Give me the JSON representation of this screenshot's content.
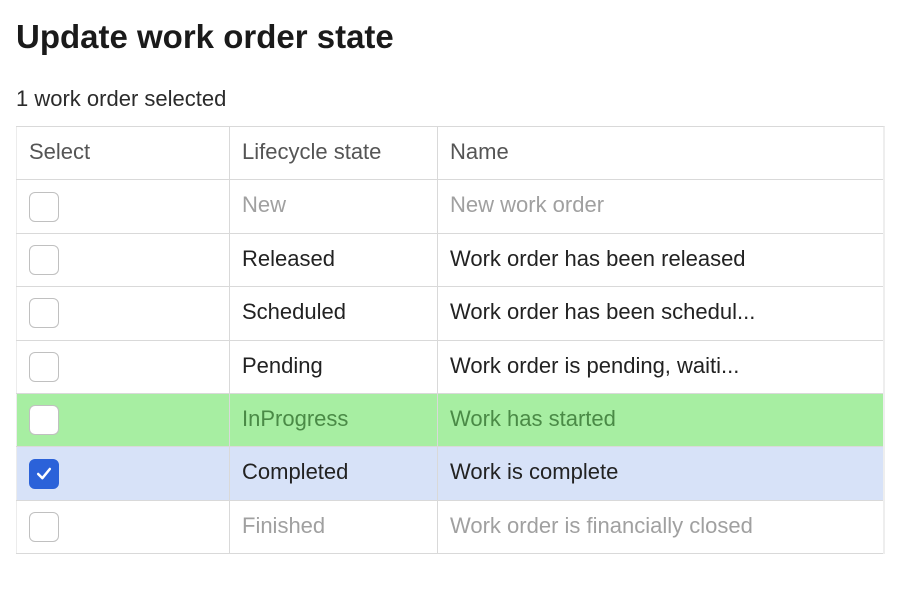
{
  "title": "Update work order state",
  "subtitle": "1 work order selected",
  "columns": {
    "select": "Select",
    "state": "Lifecycle state",
    "name": "Name"
  },
  "rows": [
    {
      "state": "New",
      "name": "New work order",
      "checked": false,
      "disabled": true,
      "highlight": "none"
    },
    {
      "state": "Released",
      "name": "Work order has been released",
      "checked": false,
      "disabled": false,
      "highlight": "none"
    },
    {
      "state": "Scheduled",
      "name": "Work order has been schedul...",
      "checked": false,
      "disabled": false,
      "highlight": "none"
    },
    {
      "state": "Pending",
      "name": "Work order is pending,  waiti...",
      "checked": false,
      "disabled": false,
      "highlight": "none"
    },
    {
      "state": "InProgress",
      "name": "Work has started",
      "checked": false,
      "disabled": false,
      "highlight": "green"
    },
    {
      "state": "Completed",
      "name": "Work is complete",
      "checked": true,
      "disabled": false,
      "highlight": "selected"
    },
    {
      "state": "Finished",
      "name": "Work order is financially closed",
      "checked": false,
      "disabled": true,
      "highlight": "none"
    }
  ]
}
